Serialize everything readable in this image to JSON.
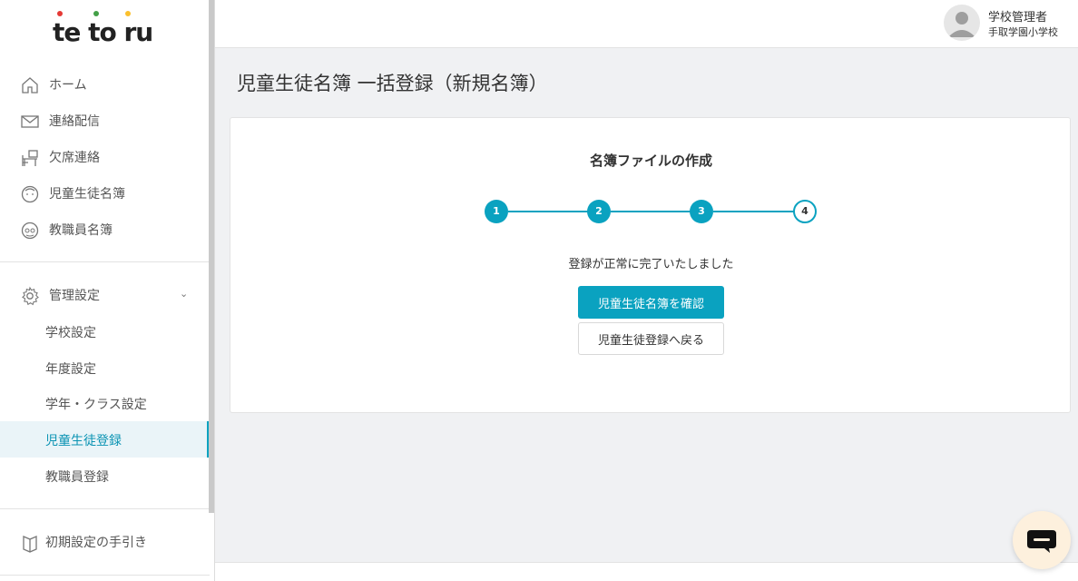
{
  "brand": {
    "logo_text": "te to ru",
    "dot_colors": [
      "#e53935",
      "#43a047",
      "#fbc02d"
    ]
  },
  "sidebar": {
    "main_items": [
      {
        "label": "ホーム",
        "icon": "home-icon"
      },
      {
        "label": "連絡配信",
        "icon": "envelope-icon"
      },
      {
        "label": "欠席連絡",
        "icon": "desk-chair-icon"
      },
      {
        "label": "児童生徒名簿",
        "icon": "child-face-icon"
      },
      {
        "label": "教職員名簿",
        "icon": "teacher-face-icon"
      }
    ],
    "settings": {
      "label": "管理設定",
      "icon": "gear-icon",
      "expanded_icon": "chevron-down-icon",
      "sub_items": [
        {
          "label": "学校設定",
          "active": false
        },
        {
          "label": "年度設定",
          "active": false
        },
        {
          "label": "学年・クラス設定",
          "active": false
        },
        {
          "label": "児童生徒登録",
          "active": true
        },
        {
          "label": "教職員登録",
          "active": false
        }
      ]
    },
    "guide": {
      "label": "初期設定の手引き",
      "icon": "book-icon"
    }
  },
  "header": {
    "user_role": "学校管理者",
    "school_name": "手取学園小学校",
    "avatar_icon": "user-avatar-icon"
  },
  "main": {
    "page_title": "児童生徒名簿 一括登録（新規名簿）",
    "card_title": "名簿ファイルの作成",
    "steps": [
      "1",
      "2",
      "3",
      "4"
    ],
    "current_step": 4,
    "message": "登録が正常に完了いたしました",
    "primary_button": "児童生徒名簿を確認",
    "secondary_button": "児童生徒登録へ戻る"
  },
  "chat": {
    "icon": "chat-bubble-icon"
  },
  "colors": {
    "accent": "#0aa2c0",
    "active_bg": "#eaf4f8"
  }
}
